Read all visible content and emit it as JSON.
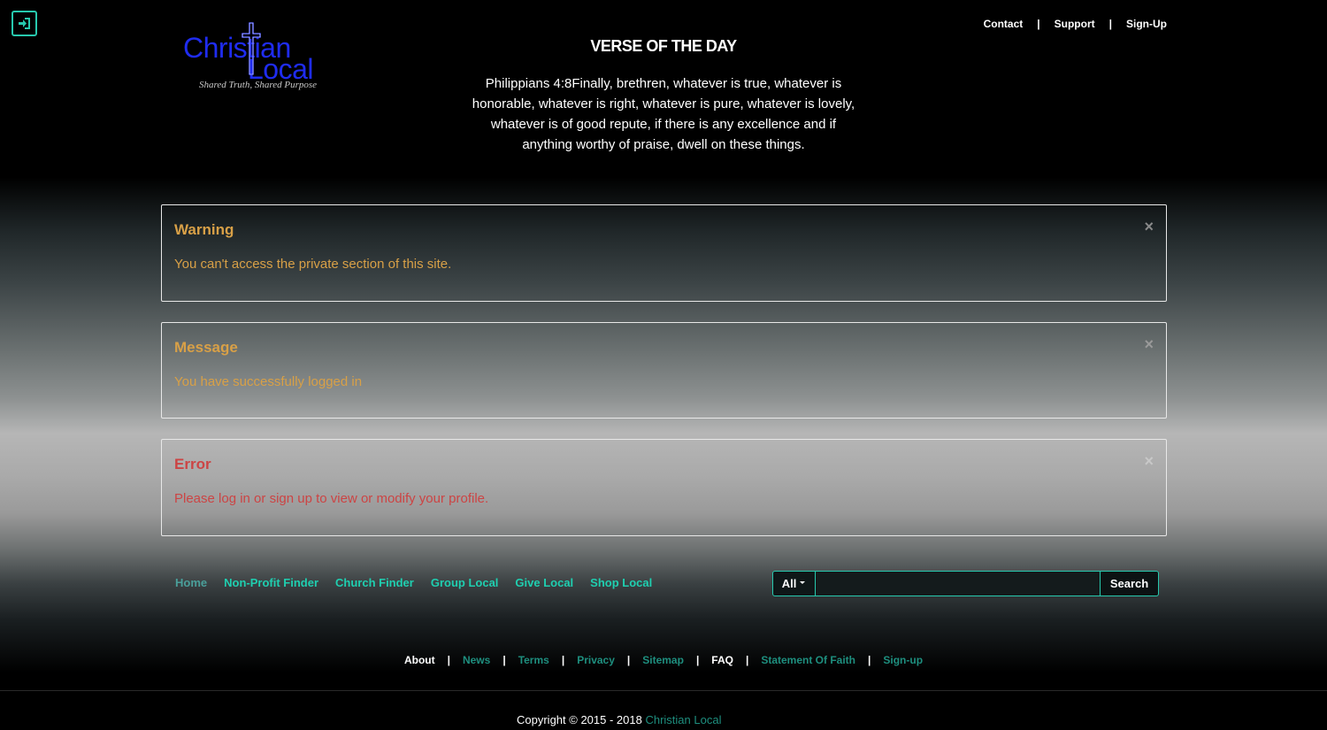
{
  "header": {
    "logo": {
      "word1": "Christian",
      "word2": "Local",
      "tagline": "Shared Truth, Shared Purpose"
    },
    "login_icon": "sign-in-icon",
    "top_links": [
      "Contact",
      "Support",
      "Sign-Up"
    ],
    "separator": "|"
  },
  "verse": {
    "title": "VERSE OF THE DAY",
    "text": "Philippians 4:8Finally, brethren, whatever is true, whatever is honorable, whatever is right, whatever is pure, whatever is lovely, whatever is of good repute, if there is any excellence and if anything worthy of praise, dwell on these things."
  },
  "alerts": [
    {
      "title": "Warning",
      "text": "You can't access the private section of this site.",
      "close": "×"
    },
    {
      "title": "Message",
      "text": "You have successfully logged in",
      "close": "×"
    },
    {
      "title": "Error",
      "text": "Please log in or sign up to view or modify your profile.",
      "close": "×"
    }
  ],
  "nav": [
    "Home",
    "Non-Profit Finder",
    "Church Finder",
    "Group Local",
    "Give Local",
    "Shop Local"
  ],
  "search": {
    "scope": "All",
    "value": "",
    "button": "Search"
  },
  "footer": {
    "links": [
      "About",
      "News",
      "Terms",
      "Privacy",
      "Sitemap",
      "FAQ",
      "Statement Of Faith",
      "Sign-up"
    ],
    "copyright": "Copyright © 2015 - 2018",
    "brand": "Christian Local"
  },
  "colors": {
    "accent": "#27c9ae",
    "warning": "#d8a047",
    "error": "#cc4444",
    "logo": "#1f2cf0"
  }
}
